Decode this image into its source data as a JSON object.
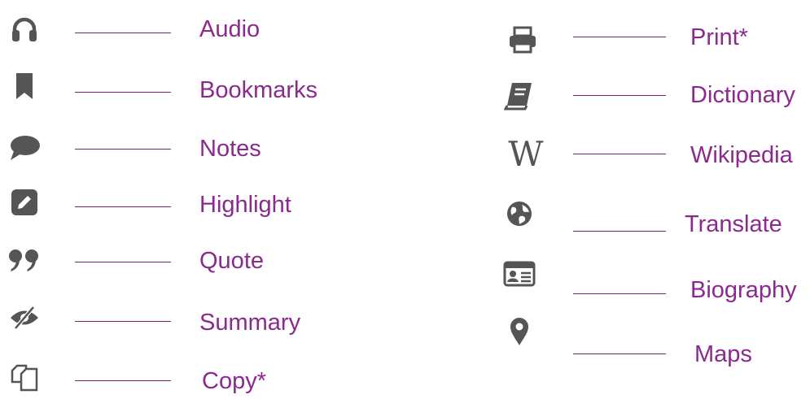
{
  "accent_color": "#8b2a8e",
  "icon_color": "#555555",
  "left_column": [
    {
      "label": "Audio",
      "icon": "headphones-icon"
    },
    {
      "label": "Bookmarks",
      "icon": "bookmark-icon"
    },
    {
      "label": "Notes",
      "icon": "speech-bubble-icon"
    },
    {
      "label": "Highlight",
      "icon": "pencil-square-icon"
    },
    {
      "label": "Quote",
      "icon": "quote-icon"
    },
    {
      "label": "Summary",
      "icon": "eye-slash-icon"
    },
    {
      "label": "Copy*",
      "icon": "copy-icon"
    }
  ],
  "right_column": [
    {
      "label": "Print*",
      "icon": "printer-icon"
    },
    {
      "label": "Dictionary",
      "icon": "book-icon"
    },
    {
      "label": "Wikipedia",
      "icon": "wikipedia-icon",
      "glyph": "W"
    },
    {
      "label": "Translate",
      "icon": "globe-icon"
    },
    {
      "label": "Biography",
      "icon": "id-card-icon"
    },
    {
      "label": "Maps",
      "icon": "map-marker-icon"
    }
  ]
}
